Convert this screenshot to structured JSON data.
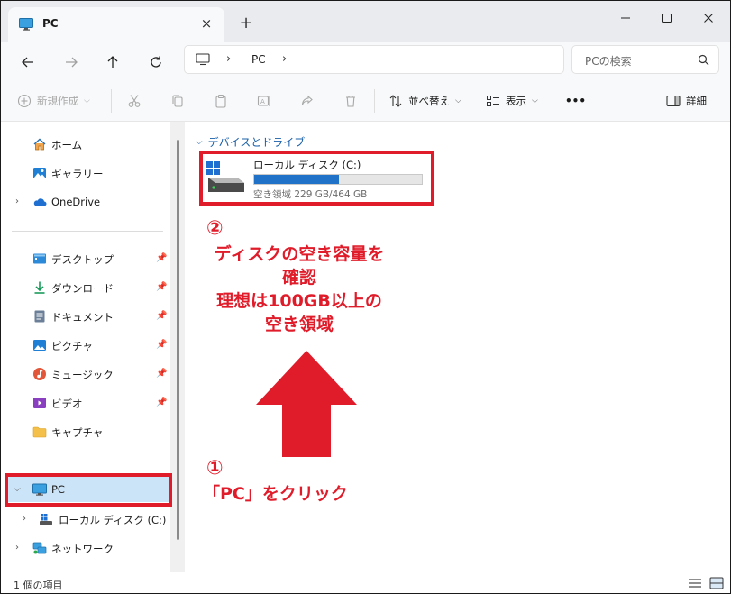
{
  "window": {
    "tab_title": "PC",
    "tab_close": "×",
    "new_tab": "+"
  },
  "address": {
    "sep1": "›",
    "location": "PC",
    "sep2": "›",
    "search_placeholder": "PCの検索"
  },
  "commands": {
    "new": "新規作成",
    "sort": "並べ替え",
    "view": "表示",
    "more": "•••",
    "details": "詳細"
  },
  "sidebar": {
    "home": "ホーム",
    "gallery": "ギャラリー",
    "onedrive": "OneDrive",
    "desktop": "デスクトップ",
    "downloads": "ダウンロード",
    "documents": "ドキュメント",
    "pictures": "ピクチャ",
    "music": "ミュージック",
    "videos": "ビデオ",
    "capture": "キャプチャ",
    "pc": "PC",
    "local_disk": "ローカル ディスク (C:)",
    "network": "ネットワーク"
  },
  "content": {
    "group_header": "デバイスとドライブ",
    "drive_name": "ローカル ディスク (C:)",
    "drive_space": "空き領域 229 GB/464 GB",
    "drive_used_fraction": 0.506
  },
  "status": {
    "item_count": "1 個の項目"
  },
  "annotations": {
    "step2_number": "②",
    "step2_line1": "ディスクの空き容量を",
    "step2_line2": "確認",
    "step2_line3": "理想は100GB以上の",
    "step2_line4": "空き領域",
    "step1_number": "①",
    "step1_text": "「PC」をクリック"
  },
  "colors": {
    "highlight": "#e01c2a",
    "accent": "#2072c9",
    "selection": "#cce4f7"
  }
}
